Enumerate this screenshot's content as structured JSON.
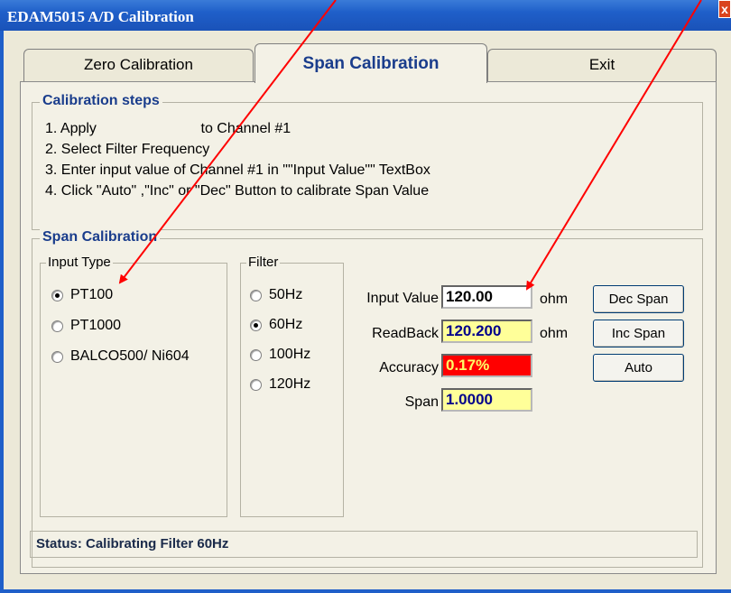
{
  "window": {
    "title": "EDAM5015 A/D Calibration",
    "close_label": "x"
  },
  "tabs": [
    {
      "label": "Zero Calibration",
      "active": false
    },
    {
      "label": "Span Calibration",
      "active": true
    },
    {
      "label": "Exit",
      "active": false
    }
  ],
  "steps": {
    "title": "Calibration steps",
    "items": [
      "1. Apply                          to Channel #1",
      "2. Select Filter Frequency",
      "3. Enter input value of Channel #1 in \"\"Input Value\"\" TextBox",
      "4. Click \"Auto\" ,\"Inc\" or \"Dec\" Button to calibrate Span Value"
    ]
  },
  "span": {
    "title": "Span Calibration",
    "input_type": {
      "title": "Input Type",
      "options": [
        "PT100",
        "PT1000",
        "BALCO500/ Ni604"
      ],
      "selected": "PT100"
    },
    "filter": {
      "title": "Filter",
      "options": [
        "50Hz",
        "60Hz",
        "100Hz",
        "120Hz"
      ],
      "selected": "60Hz"
    },
    "input_value": {
      "label": "Input Value",
      "value": "120.00",
      "unit": "ohm"
    },
    "readback": {
      "label": "ReadBack",
      "value": "120.200",
      "unit": "ohm"
    },
    "accuracy": {
      "label": "Accuracy",
      "value": "0.17%"
    },
    "span_value": {
      "label": "Span",
      "value": "1.0000"
    },
    "buttons": {
      "dec": "Dec Span",
      "inc": "Inc Span",
      "auto": "Auto"
    }
  },
  "status": "Status: Calibrating Filter 60Hz",
  "colors": {
    "title_bar": "#1f5fc9",
    "arrow": "#ff0000",
    "accent_text": "#1a3d8c"
  }
}
